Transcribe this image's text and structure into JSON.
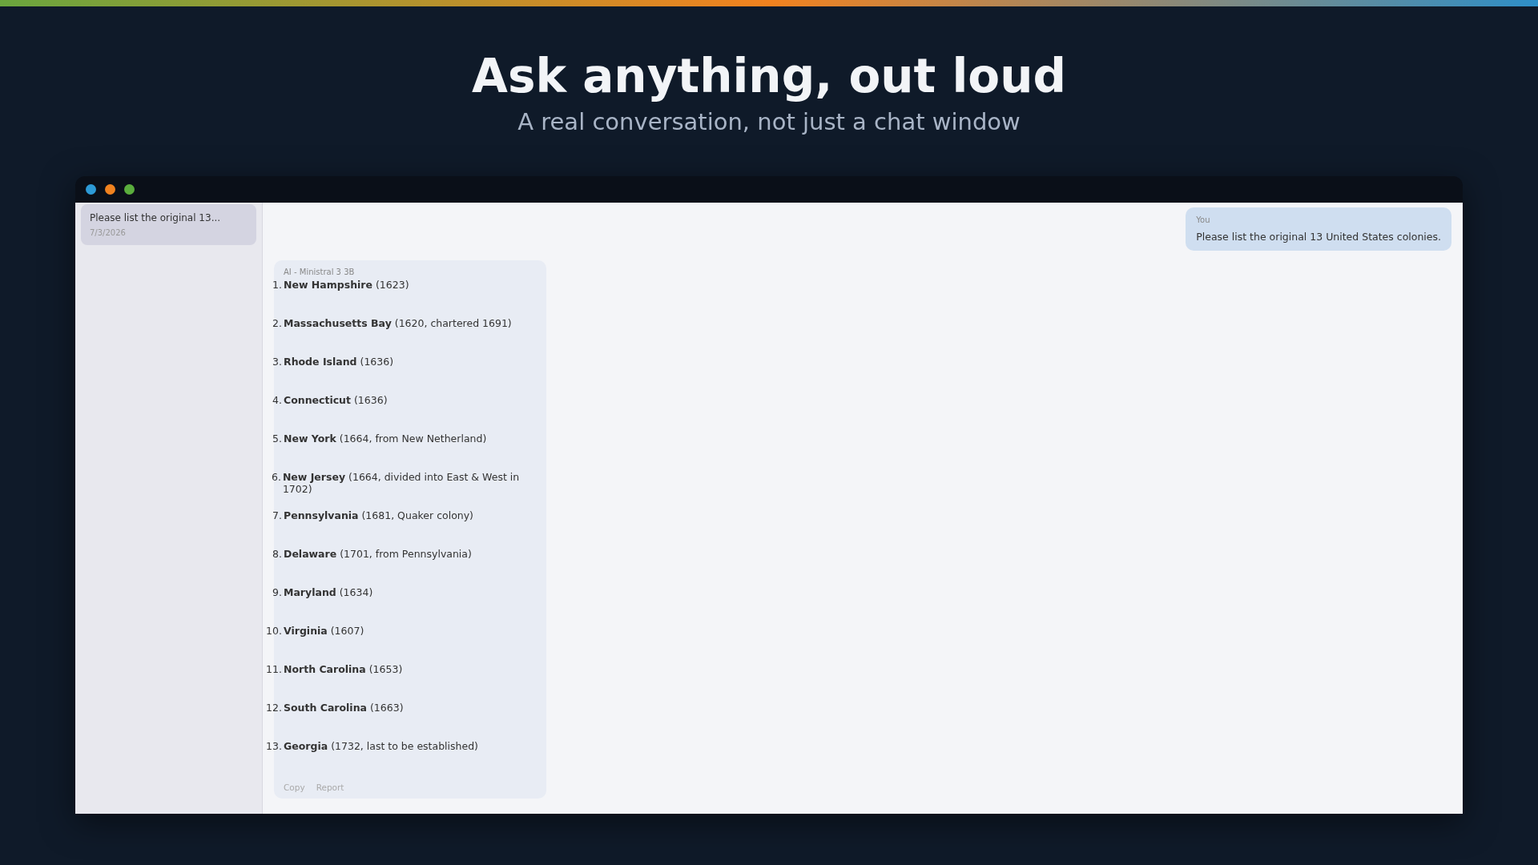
{
  "hero": {
    "title": "Ask anything, out loud",
    "subtitle": "A real conversation, not just a chat window"
  },
  "sidebar": {
    "items": [
      {
        "title": "Please list the original 13...",
        "date": "7/3/2026",
        "selected": true
      }
    ]
  },
  "messages": [
    {
      "kind": "user",
      "author": "You",
      "text": "Please list the original 13 United States colonies."
    },
    {
      "kind": "ai",
      "author": "AI - Ministral 3 3B",
      "items": [
        {
          "number": "1.",
          "name": "New Hampshire",
          "detail": "(1623)"
        },
        {
          "number": "2.",
          "name": "Massachusetts Bay",
          "detail": "(1620, chartered 1691)"
        },
        {
          "number": "3.",
          "name": "Rhode Island",
          "detail": "(1636)"
        },
        {
          "number": "4.",
          "name": "Connecticut",
          "detail": "(1636)"
        },
        {
          "number": "5.",
          "name": "New York",
          "detail": "(1664, from New Netherland)"
        },
        {
          "number": "6.",
          "name": "New Jersey",
          "detail": "(1664, divided into East & West in 1702)"
        },
        {
          "number": "7.",
          "name": "Pennsylvania",
          "detail": "(1681, Quaker colony)"
        },
        {
          "number": "8.",
          "name": "Delaware",
          "detail": "(1701, from Pennsylvania)"
        },
        {
          "number": "9.",
          "name": "Maryland",
          "detail": "(1634)"
        },
        {
          "number": "10.",
          "name": "Virginia",
          "detail": "(1607)"
        },
        {
          "number": "11.",
          "name": "North Carolina",
          "detail": "(1653)"
        },
        {
          "number": "12.",
          "name": "South Carolina",
          "detail": "(1663)"
        },
        {
          "number": "13.",
          "name": "Georgia",
          "detail": "(1732, last to be established)"
        }
      ],
      "actions": [
        "Copy",
        "Report"
      ]
    }
  ]
}
